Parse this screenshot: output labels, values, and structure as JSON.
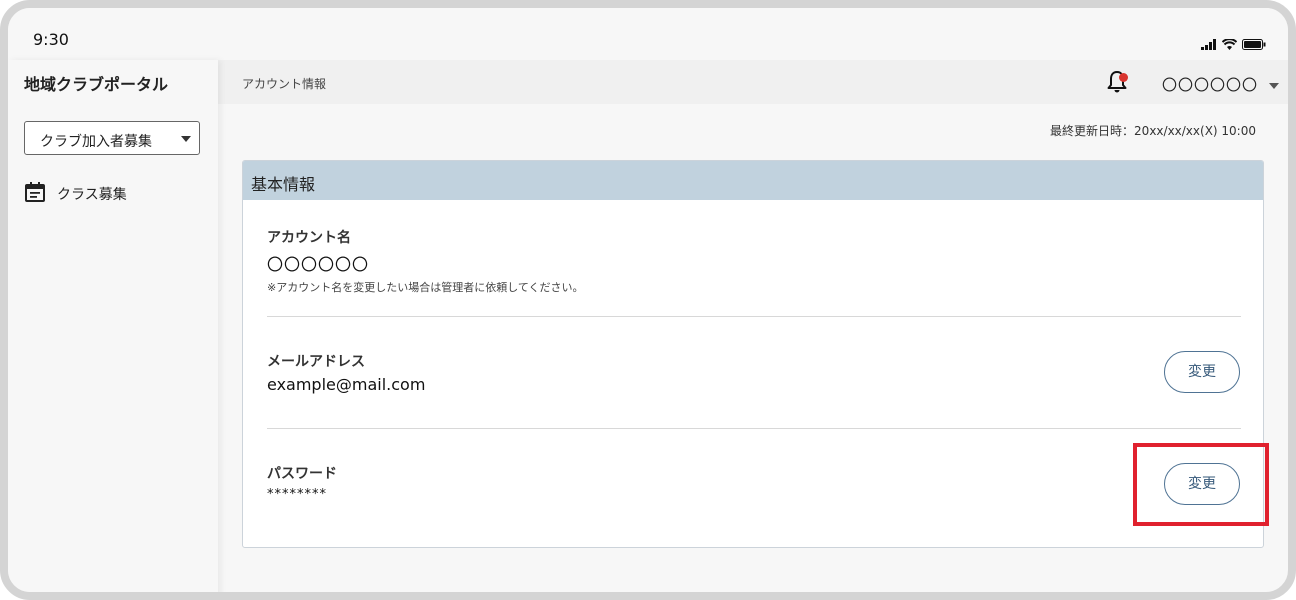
{
  "status_bar": {
    "time": "9:30"
  },
  "sidebar": {
    "brand": "地域クラブポータル",
    "selector": {
      "selected": "クラブ加入者募集"
    },
    "items": [
      {
        "label": "クラス募集",
        "icon": "calendar-icon"
      }
    ]
  },
  "topbar": {
    "breadcrumb": "アカウント情報",
    "notification_icon": "bell-icon",
    "user_name": "〇〇〇〇〇〇"
  },
  "last_updated": "最終更新日時：20xx/xx/xx(X) 10:00",
  "card": {
    "title": "基本情報",
    "account": {
      "label": "アカウント名",
      "value": "〇〇〇〇〇〇",
      "note": "※アカウント名を変更したい場合は管理者に依頼してください。"
    },
    "email": {
      "label": "メールアドレス",
      "value": "example@mail.com",
      "button": "変更"
    },
    "password": {
      "label": "パスワード",
      "value": "********",
      "button": "変更"
    }
  },
  "colors": {
    "card_header": "#c1d2de",
    "button_border": "#4f7394",
    "highlight": "#e0212e",
    "notification_dot": "#d9352f"
  }
}
